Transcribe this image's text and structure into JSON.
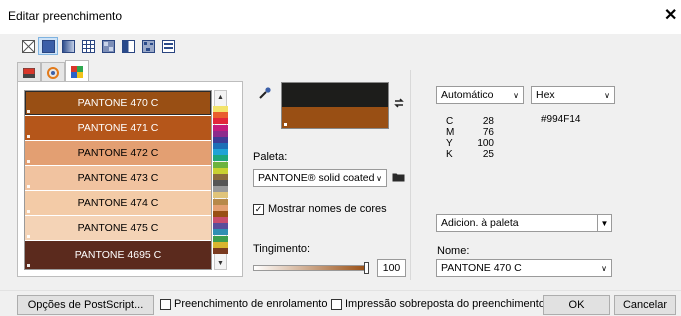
{
  "window": {
    "title": "Editar preenchimento"
  },
  "fill_types": [
    "no-fill",
    "uniform-fill",
    "fountain-fill",
    "pattern-vector",
    "pattern-bitmap",
    "two-color",
    "texture",
    "postscript"
  ],
  "swatches": [
    {
      "name": "PANTONE 470 C",
      "color": "#994f14",
      "text": "#ffffff",
      "selected": true
    },
    {
      "name": "PANTONE 471 C",
      "color": "#b5561a",
      "text": "#ffffff",
      "selected": false
    },
    {
      "name": "PANTONE 472 C",
      "color": "#e39f72",
      "text": "#000000",
      "selected": false
    },
    {
      "name": "PANTONE 473 C",
      "color": "#f1c3a0",
      "text": "#000000",
      "selected": false
    },
    {
      "name": "PANTONE 474 C",
      "color": "#f3cba7",
      "text": "#000000",
      "selected": false
    },
    {
      "name": "PANTONE 475 C",
      "color": "#f4d3b6",
      "text": "#000000",
      "selected": false
    },
    {
      "name": "PANTONE 4695 C",
      "color": "#5b2a1d",
      "text": "#ffffff",
      "selected": false
    }
  ],
  "color_strip": [
    "#f2e36a",
    "#e95e2d",
    "#e2263a",
    "#c31d7d",
    "#8d2b8c",
    "#3d3c96",
    "#1d6fb7",
    "#20a3d5",
    "#1ea67a",
    "#6cb33f",
    "#c9d131",
    "#8a6b3c",
    "#555555",
    "#999999",
    "#e0c47a",
    "#b7894a",
    "#e39f72",
    "#994f14",
    "#c84d6e",
    "#5a4d9a",
    "#2f8fb3",
    "#3d9e4d",
    "#d8b52e",
    "#7a3a1f"
  ],
  "preview": {
    "top_color": "#1d1d1b",
    "bottom_color": "#994f14"
  },
  "palette": {
    "label": "Paleta:",
    "value": "PANTONE® solid coated"
  },
  "show_names": {
    "label": "Mostrar nomes de cores",
    "checked": true
  },
  "tint": {
    "label": "Tingimento:",
    "value": "100",
    "level": 1.0
  },
  "model": {
    "value": "Automático"
  },
  "format": {
    "value": "Hex"
  },
  "hex_value": "#994F14",
  "cmyk": [
    {
      "label": "C",
      "value": "28"
    },
    {
      "label": "M",
      "value": "76"
    },
    {
      "label": "Y",
      "value": "100"
    },
    {
      "label": "K",
      "value": "25"
    }
  ],
  "add_palette": {
    "value": "Adicion. à paleta"
  },
  "name_field": {
    "label": "Nome:",
    "value": "PANTONE 470 C"
  },
  "footer": {
    "postscript": "Opções de PostScript...",
    "wrap_fill": "Preenchimento de enrolamento",
    "overprint": "Impressão sobreposta do preenchimento",
    "ok": "OK",
    "cancel": "Cancelar"
  }
}
